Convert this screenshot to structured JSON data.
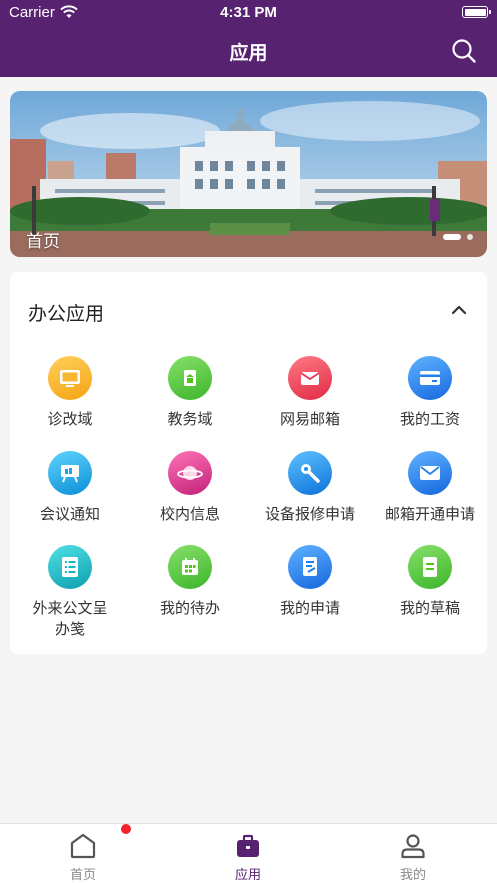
{
  "status_bar": {
    "carrier": "Carrier",
    "time": "4:31 PM"
  },
  "nav": {
    "title": "应用"
  },
  "banner": {
    "caption": "首页"
  },
  "section": {
    "title": "办公应用",
    "apps": [
      {
        "label": "诊改域",
        "icon": "monitor-icon",
        "color": "#f7a21b"
      },
      {
        "label": "教务域",
        "icon": "building-icon",
        "color": "#52c41a"
      },
      {
        "label": "网易邮箱",
        "icon": "envelope-icon",
        "color": "#ef3f55"
      },
      {
        "label": "我的工资",
        "icon": "card-icon",
        "color": "#1f7ff0"
      },
      {
        "label": "会议通知",
        "icon": "easel-icon",
        "color": "#17a8e3"
      },
      {
        "label": "校内信息",
        "icon": "planet-icon",
        "color": "#e83e8c"
      },
      {
        "label": "设备报修申请",
        "icon": "wrench-icon",
        "color": "#1a8ff0"
      },
      {
        "label": "邮箱开通申请",
        "icon": "mail-icon",
        "color": "#1f7ff0"
      },
      {
        "label": "外来公文呈\n办笺",
        "icon": "document-list-icon",
        "color": "#17b5c4"
      },
      {
        "label": "我的待办",
        "icon": "calendar-icon",
        "color": "#52c41a"
      },
      {
        "label": "我的申请",
        "icon": "edit-doc-icon",
        "color": "#1f7ff0"
      },
      {
        "label": "我的草稿",
        "icon": "draft-icon",
        "color": "#52c41a"
      }
    ]
  },
  "tabbar": {
    "items": [
      {
        "label": "首页",
        "icon": "home-icon",
        "active": false,
        "badge": true
      },
      {
        "label": "应用",
        "icon": "briefcase-icon",
        "active": true
      },
      {
        "label": "我的",
        "icon": "person-icon",
        "active": false
      }
    ]
  },
  "colors": {
    "brand": "#572270",
    "badge": "#f5222d"
  }
}
